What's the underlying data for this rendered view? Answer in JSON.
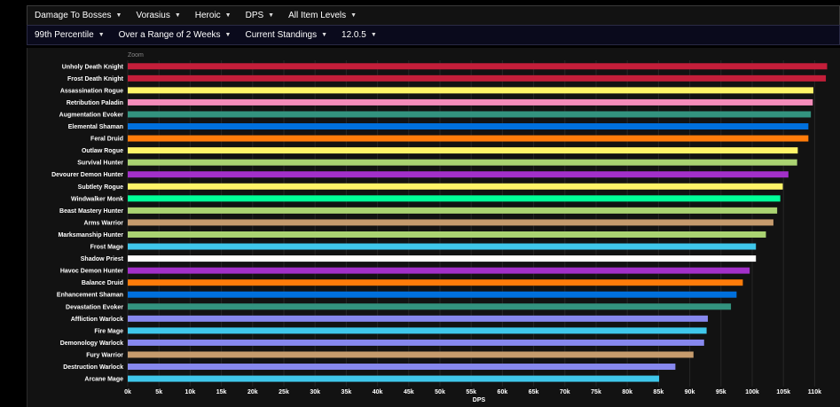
{
  "filters_row1": [
    {
      "label": "Damage To Bosses"
    },
    {
      "label": "Vorasius"
    },
    {
      "label": "Heroic"
    },
    {
      "label": "DPS"
    },
    {
      "label": "All Item Levels"
    }
  ],
  "filters_row2": [
    {
      "label": "99th Percentile"
    },
    {
      "label": "Over a Range of 2 Weeks"
    },
    {
      "label": "Current Standings"
    },
    {
      "label": "12.0.5"
    }
  ],
  "zoom_label": "Zoom",
  "chart_data": {
    "type": "bar",
    "orientation": "horizontal",
    "xlabel": "DPS",
    "xlim": [
      0,
      112500
    ],
    "xticks": [
      0,
      5000,
      10000,
      15000,
      20000,
      25000,
      30000,
      35000,
      40000,
      45000,
      50000,
      55000,
      60000,
      65000,
      70000,
      75000,
      80000,
      85000,
      90000,
      95000,
      100000,
      105000,
      110000
    ],
    "xtick_labels": [
      "0k",
      "5k",
      "10k",
      "15k",
      "20k",
      "25k",
      "30k",
      "35k",
      "40k",
      "45k",
      "50k",
      "55k",
      "60k",
      "65k",
      "70k",
      "75k",
      "80k",
      "85k",
      "90k",
      "95k",
      "100k",
      "105k",
      "110k"
    ],
    "grid": true,
    "categories": [
      "Unholy Death Knight",
      "Frost Death Knight",
      "Assassination Rogue",
      "Retribution Paladin",
      "Augmentation Evoker",
      "Elemental Shaman",
      "Feral Druid",
      "Outlaw Rogue",
      "Survival Hunter",
      "Devourer Demon Hunter",
      "Subtlety Rogue",
      "Windwalker Monk",
      "Beast Mastery Hunter",
      "Arms Warrior",
      "Marksmanship Hunter",
      "Frost Mage",
      "Shadow Priest",
      "Havoc Demon Hunter",
      "Balance Druid",
      "Enhancement Shaman",
      "Devastation Evoker",
      "Affliction Warlock",
      "Fire Mage",
      "Demonology Warlock",
      "Fury Warrior",
      "Destruction Warlock",
      "Arcane Mage"
    ],
    "values": [
      112000,
      111800,
      109800,
      109700,
      109400,
      109000,
      109000,
      107300,
      107200,
      105800,
      104900,
      104500,
      104000,
      103400,
      102200,
      100600,
      100600,
      99600,
      98500,
      97500,
      96600,
      92900,
      92700,
      92300,
      90600,
      87700,
      85100
    ],
    "colors": [
      "#C41E3A",
      "#C41E3A",
      "#FFF468",
      "#F48CBA",
      "#33937F",
      "#0070DD",
      "#FF7C0A",
      "#FFF468",
      "#AAD372",
      "#A330C9",
      "#FFF468",
      "#00FF98",
      "#AAD372",
      "#C69B6D",
      "#AAD372",
      "#3FC7EB",
      "#FFFFFF",
      "#A330C9",
      "#FF7C0A",
      "#0070DD",
      "#33937F",
      "#8788EE",
      "#3FC7EB",
      "#8788EE",
      "#C69B6D",
      "#8788EE",
      "#3FC7EB"
    ]
  }
}
